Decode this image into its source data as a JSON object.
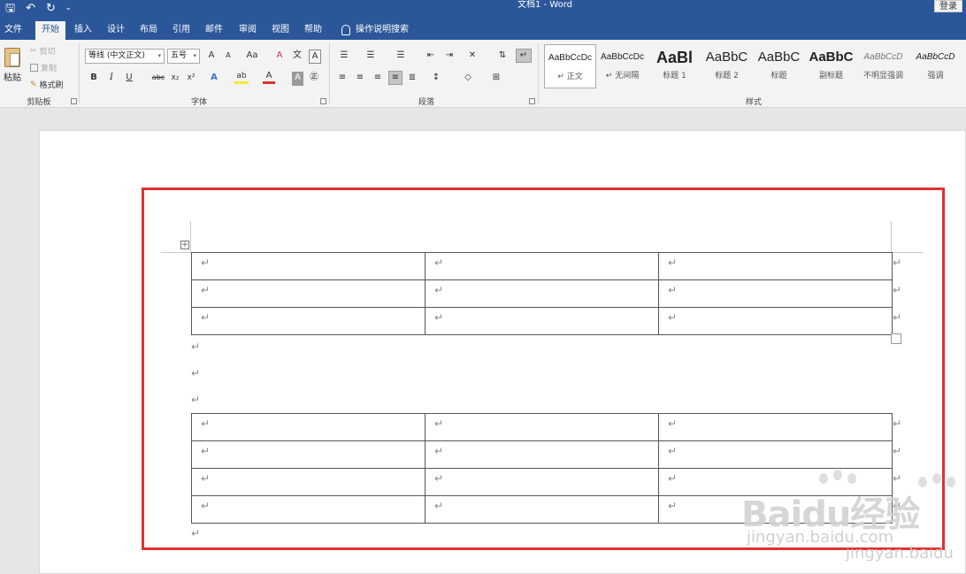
{
  "app": {
    "title": "文档1 - Word",
    "login_label": "登录"
  },
  "qat": {
    "save_icon": "save-icon",
    "undo_icon": "undo-icon",
    "redo_icon": "redo-icon",
    "customize_icon": "customize-qat-icon"
  },
  "tabs": [
    {
      "label": "文件"
    },
    {
      "label": "开始"
    },
    {
      "label": "插入"
    },
    {
      "label": "设计"
    },
    {
      "label": "布局"
    },
    {
      "label": "引用"
    },
    {
      "label": "邮件"
    },
    {
      "label": "审阅"
    },
    {
      "label": "视图"
    },
    {
      "label": "帮助"
    }
  ],
  "tell_me": "操作说明搜索",
  "clipboard": {
    "paste": "粘贴",
    "cut": "剪切",
    "copy": "复制",
    "format_painter": "格式刷",
    "group_label": "剪贴板"
  },
  "font": {
    "font_name": "等线 (中文正文)",
    "font_size": "五号",
    "grow": "A",
    "shrink": "A",
    "change_case": "Aa",
    "clear": "A",
    "phonetic": "文",
    "border": "A",
    "bold": "B",
    "italic": "I",
    "underline": "U",
    "strike": "abc",
    "subscript": "x₂",
    "superscript": "x²",
    "effects": "A",
    "highlight": "ab",
    "font_color": "A",
    "shading": "A",
    "enclose": "㊣",
    "group_label": "字体"
  },
  "paragraph": {
    "group_label": "段落"
  },
  "styles": {
    "group_label": "样式",
    "items": [
      {
        "sample": "AaBbCcDc",
        "name": "↵ 正文"
      },
      {
        "sample": "AaBbCcDc",
        "name": "↵ 无间隔"
      },
      {
        "sample": "AaBl",
        "name": "标题 1"
      },
      {
        "sample": "AaBbC",
        "name": "标题 2"
      },
      {
        "sample": "AaBbC",
        "name": "标题"
      },
      {
        "sample": "AaBbC",
        "name": "副标题"
      },
      {
        "sample": "AaBbCcD",
        "name": "不明显强调"
      },
      {
        "sample": "AaBbCcD",
        "name": "强调"
      }
    ]
  },
  "document": {
    "cell_mark": "↵",
    "para_mark": "↵",
    "table1_rows": 3,
    "table2_rows": 4,
    "move_handle": "⊹"
  },
  "watermark": {
    "brand": "Baidu经验",
    "url1": "jingyan.baidu.com",
    "url2": "jingyan.baidu"
  }
}
